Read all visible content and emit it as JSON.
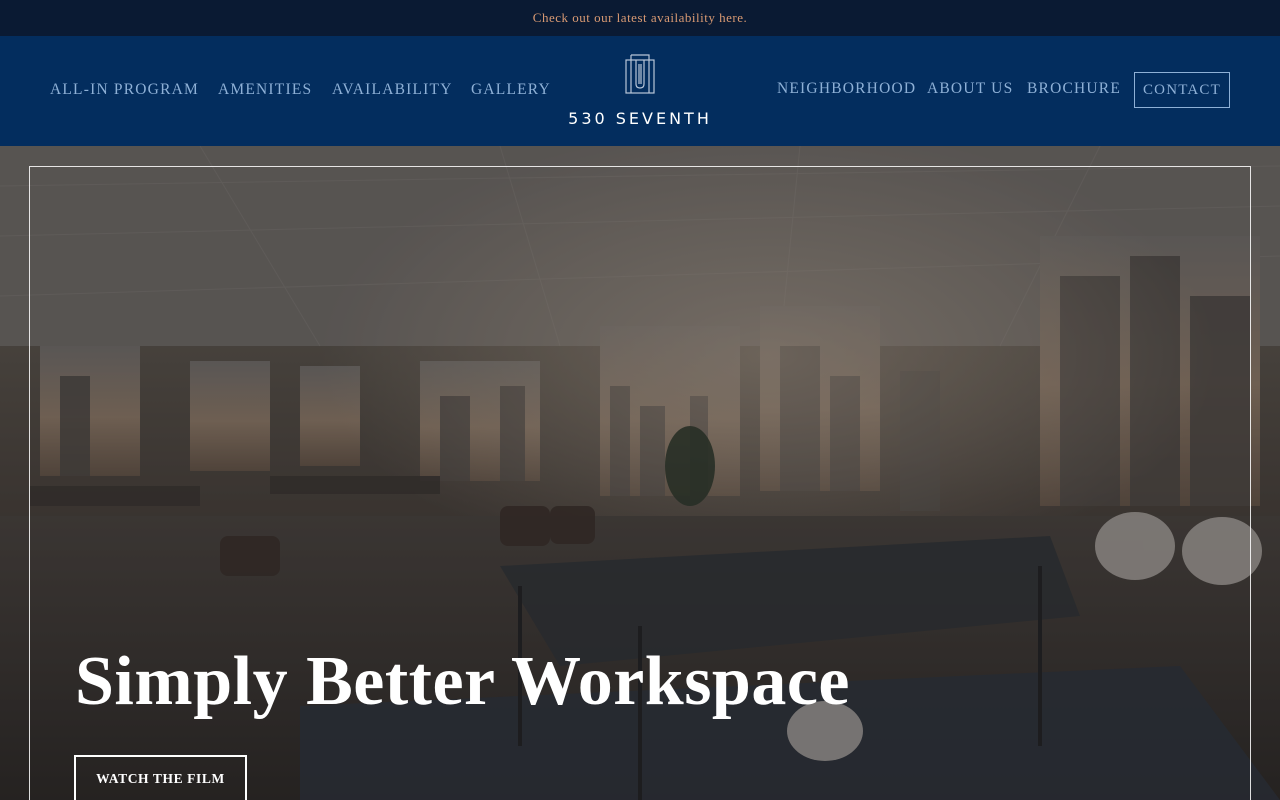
{
  "announcement": {
    "text": "Check out our latest availability here."
  },
  "nav": {
    "left": [
      {
        "label": "ALL-IN PROGRAM"
      },
      {
        "label": "AMENITIES"
      },
      {
        "label": "AVAILABILITY"
      },
      {
        "label": "GALLERY"
      }
    ],
    "right": [
      {
        "label": "NEIGHBORHOOD"
      },
      {
        "label": "ABOUT US"
      },
      {
        "label": "BROCHURE"
      }
    ],
    "contact_label": "CONTACT"
  },
  "logo": {
    "text": "530 SEVENTH",
    "icon": "building-logo-icon"
  },
  "hero": {
    "title": "Simply Better Workspace",
    "button_label": "WATCH THE FILM",
    "image": "office-interior-with-skyline-view"
  },
  "colors": {
    "announcement_bg": "#0a1a33",
    "announcement_text": "#d99a73",
    "nav_bg": "#032d5e",
    "nav_text": "#8eb0d6",
    "hero_text": "#ffffff"
  }
}
